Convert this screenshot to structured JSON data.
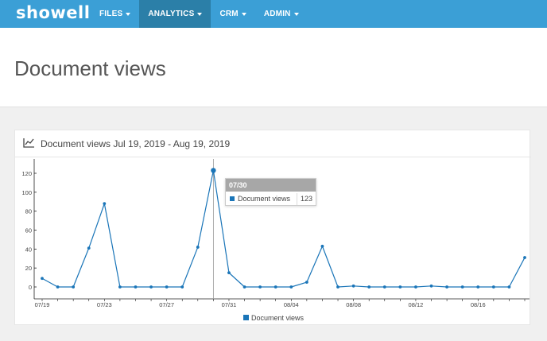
{
  "app": {
    "logo": "showell",
    "nav": [
      {
        "label": "FILES",
        "active": false
      },
      {
        "label": "ANALYTICS",
        "active": true
      },
      {
        "label": "CRM",
        "active": false
      },
      {
        "label": "ADMIN",
        "active": false
      }
    ]
  },
  "page": {
    "title": "Document views"
  },
  "card": {
    "title": "Document views Jul 19, 2019 - Aug 19, 2019"
  },
  "tooltip": {
    "date": "07/30",
    "label": "Document views",
    "value": "123"
  },
  "legend": {
    "label": "Document views"
  },
  "colors": {
    "topbar": "#3b9fd6",
    "nav_active": "#2b7fa8",
    "series": "#1a75b8"
  },
  "chart_data": {
    "type": "line",
    "x": [
      "07/19",
      "07/20",
      "07/21",
      "07/22",
      "07/23",
      "07/24",
      "07/25",
      "07/26",
      "07/27",
      "07/28",
      "07/29",
      "07/30",
      "07/31",
      "08/01",
      "08/02",
      "08/03",
      "08/04",
      "08/05",
      "08/06",
      "08/07",
      "08/08",
      "08/09",
      "08/10",
      "08/11",
      "08/12",
      "08/13",
      "08/14",
      "08/15",
      "08/16",
      "08/17",
      "08/18",
      "08/19"
    ],
    "x_tick_labels": [
      "07/19",
      "07/23",
      "07/27",
      "07/31",
      "08/04",
      "08/08",
      "08/12",
      "08/16"
    ],
    "series": [
      {
        "name": "Document views",
        "values": [
          9,
          0,
          0,
          41,
          88,
          0,
          0,
          0,
          0,
          0,
          42,
          123,
          15,
          0,
          0,
          0,
          0,
          5,
          43,
          0,
          1,
          0,
          0,
          0,
          0,
          1,
          0,
          0,
          0,
          0,
          0,
          31
        ]
      }
    ],
    "ylim": [
      0,
      120
    ],
    "y_ticks": [
      0,
      20,
      40,
      60,
      80,
      100,
      120
    ],
    "highlight_index": 11,
    "legend_position": "bottom-center"
  }
}
